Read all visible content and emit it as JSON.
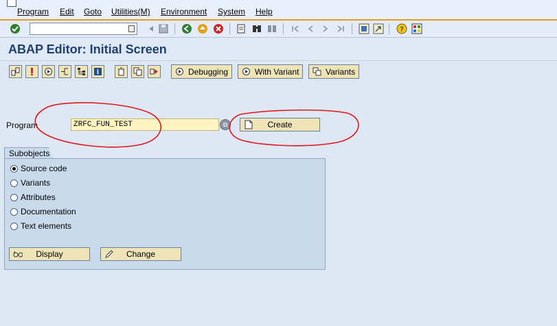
{
  "menubar": {
    "items": [
      "Program",
      "Edit",
      "Goto",
      "Utilities(M)",
      "Environment",
      "System",
      "Help"
    ]
  },
  "toolbar": {
    "command_value": ""
  },
  "page": {
    "title": "ABAP Editor: Initial Screen"
  },
  "app_toolbar": {
    "debugging_label": "Debugging",
    "with_variant_label": "With Variant",
    "variants_label": "Variants"
  },
  "program": {
    "label": "Program",
    "value": "ZRFC_FUN_TEST",
    "create_label": "Create"
  },
  "subobjects": {
    "title": "Subobjects",
    "options": [
      {
        "label": "Source code",
        "selected": true
      },
      {
        "label": "Variants",
        "selected": false
      },
      {
        "label": "Attributes",
        "selected": false
      },
      {
        "label": "Documentation",
        "selected": false
      },
      {
        "label": "Text elements",
        "selected": false
      }
    ],
    "display_label": "Display",
    "change_label": "Change"
  },
  "colors": {
    "accent_orange": "#e49a2a",
    "title_blue": "#1f3f6e",
    "annotation_red": "#e0161e"
  }
}
